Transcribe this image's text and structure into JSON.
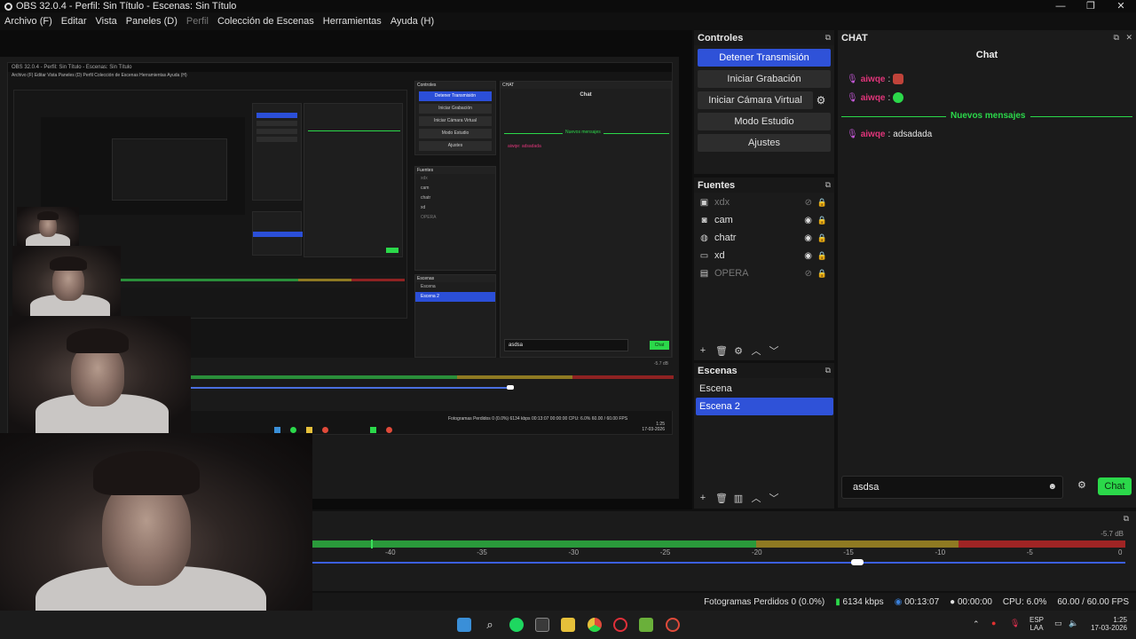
{
  "window": {
    "title": "OBS 32.0.4 - Perfil: Sin Título - Escenas: Sin Título",
    "minimize": "—",
    "maximize": "❐",
    "close": "✕"
  },
  "menu": {
    "items": [
      "Archivo (F)",
      "Editar",
      "Vista",
      "Paneles (D)",
      "Perfil",
      "Colección de Escenas",
      "Herramientas",
      "Ayuda (H)"
    ]
  },
  "nested_preview": {
    "title": "OBS 32.0.4 - Perfil: Sin Título - Escenas: Sin Título",
    "menu": "Archivo (F)   Editar   Vista   Paneles (D)   Perfil   Colección de Escenas   Herramientas   Ayuda (H)",
    "controls_head": "Controles",
    "buttons": [
      "Detener Transmisión",
      "Iniciar Grabación",
      "Iniciar Cámara Virtual",
      "Modo Estudio",
      "Ajustes"
    ],
    "sources_head": "Fuentes",
    "sources": [
      "xdx",
      "cam",
      "chatr",
      "xd",
      "OPERA"
    ],
    "scenes_head": "Escenas",
    "scenes": [
      "Escena",
      "Escena 2"
    ],
    "chat_head": "CHAT",
    "chat_title": "Chat",
    "new_messages": "Nuevos mensajes",
    "msg": "aiwqe: adsadada",
    "input": "asdsa",
    "send": "Chat",
    "status": "Fotogramas Perdidos 0 (0.0%)   6134 kbps   00:13:07   00:00:00   CPU: 6.0%   60.00 / 60.00 FPS",
    "db": "-5.7 dB",
    "ticks": [
      "-40",
      "-35",
      "-30",
      "-25",
      "-20",
      "-15",
      "-10",
      "-5",
      "0"
    ],
    "clock_time": "1:25",
    "clock_date": "17-03-2026"
  },
  "controls": {
    "header": "Controles",
    "stop_stream": "Detener Transmisión",
    "start_record": "Iniciar Grabación",
    "start_virtual_cam": "Iniciar Cámara Virtual",
    "studio_mode": "Modo Estudio",
    "settings": "Ajustes"
  },
  "sources": {
    "header": "Fuentes",
    "items": [
      {
        "label": "xdx",
        "icon": "image-icon",
        "visible": false
      },
      {
        "label": "cam",
        "icon": "camera-icon",
        "visible": true
      },
      {
        "label": "chatr",
        "icon": "browser-icon",
        "visible": true
      },
      {
        "label": "xd",
        "icon": "display-icon",
        "visible": true
      },
      {
        "label": "OPERA",
        "icon": "window-icon",
        "visible": false
      }
    ]
  },
  "scenes": {
    "header": "Escenas",
    "items": [
      "Escena",
      "Escena 2"
    ],
    "selected": "Escena 2"
  },
  "chat": {
    "header": "CHAT",
    "title": "Chat",
    "messages": [
      {
        "user": "aiwqe",
        "text": ""
      },
      {
        "user": "aiwqe",
        "text": ""
      },
      {
        "user": "aiwqe",
        "text": "adsadada"
      }
    ],
    "new_messages": "Nuevos mensajes",
    "input_value": "asdsa",
    "send_label": "Chat"
  },
  "mixer": {
    "db_readout": "-5.7 dB",
    "ticks": [
      "-40",
      "-35",
      "-30",
      "-25",
      "-20",
      "-15",
      "-10",
      "-5",
      "0"
    ],
    "volume_fraction": 0.67
  },
  "status": {
    "dropped_frames": "Fotogramas Perdidos 0 (0.0%)",
    "bitrate": "6134 kbps",
    "stream_time": "00:13:07",
    "record_time": "00:00:00",
    "cpu": "CPU: 6.0%",
    "fps": "60.00 / 60.00 FPS"
  },
  "taskbar": {
    "lang": "ESP",
    "lang_sub": "LAA",
    "time": "1:25",
    "date": "17-03-2026"
  },
  "colors": {
    "accent_blue": "#2f52d8",
    "chat_green": "#2bd84a",
    "username_pink": "#e0357a",
    "mic_purple": "#c558d8"
  }
}
